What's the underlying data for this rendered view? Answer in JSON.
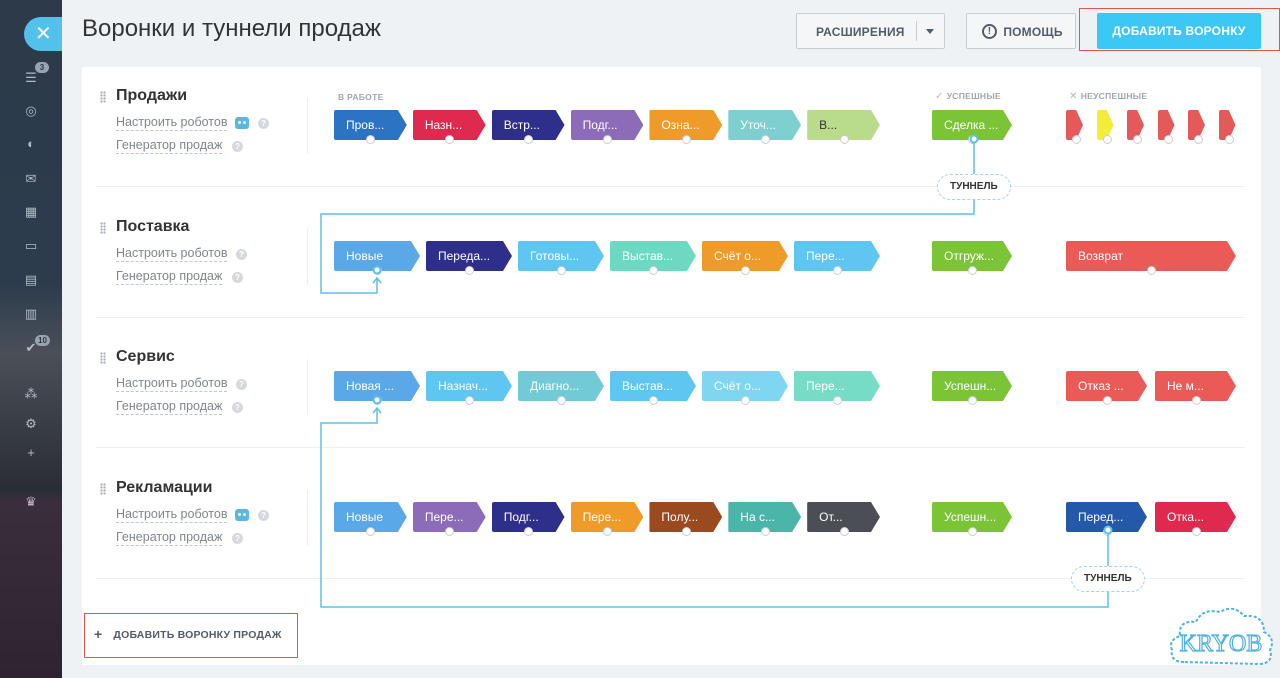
{
  "header": {
    "title": "Воронки и туннели продаж",
    "extensions_label": "РАСШИРЕНИЯ",
    "help_label": "ПОМОЩЬ",
    "add_funnel_label": "ДОБАВИТЬ ВОРОНКУ"
  },
  "sidebar": {
    "badges": [
      "3",
      "10"
    ]
  },
  "column_headers": {
    "in_work": "В РАБОТЕ",
    "success": "УСПЕШНЫЕ",
    "fail": "НЕУСПЕШНЫЕ"
  },
  "links": {
    "robots": "Настроить роботов",
    "generator": "Генератор продаж"
  },
  "funnels": [
    {
      "name": "Продажи",
      "stages": [
        {
          "label": "Пров...",
          "color": "#2d73c4"
        },
        {
          "label": "Назн...",
          "color": "#e0294f"
        },
        {
          "label": "Встр...",
          "color": "#2e2f8a"
        },
        {
          "label": "Подг...",
          "color": "#8c6bb8"
        },
        {
          "label": "Озна...",
          "color": "#ef9b2a"
        },
        {
          "label": "Уточ...",
          "color": "#7dcfd0"
        },
        {
          "label": "В...",
          "color": "#b8db8c"
        }
      ],
      "success": [
        {
          "label": "Сделка ...",
          "color": "#7bc436"
        }
      ],
      "fail_flags": [
        "#e45a5a",
        "#f2ed3a",
        "#e45a5a",
        "#e45a5a",
        "#e45a5a",
        "#e45a5a"
      ]
    },
    {
      "name": "Поставка",
      "stages": [
        {
          "label": "Новые",
          "color": "#5aa8e8"
        },
        {
          "label": "Переда...",
          "color": "#2e2f8a"
        },
        {
          "label": "Готовы...",
          "color": "#5ec6f0"
        },
        {
          "label": "Выстав...",
          "color": "#6ed9c2"
        },
        {
          "label": "Счёт о...",
          "color": "#ef9b2a"
        },
        {
          "label": "Пере...",
          "color": "#5ec6f0"
        }
      ],
      "success": [
        {
          "label": "Отгруж...",
          "color": "#7bc436"
        }
      ],
      "fail": [
        {
          "label": "Возврат",
          "color": "#ea5b58"
        }
      ]
    },
    {
      "name": "Сервис",
      "stages": [
        {
          "label": "Новая ...",
          "color": "#5aa8e8"
        },
        {
          "label": "Назнач...",
          "color": "#5ec6f0"
        },
        {
          "label": "Диагно...",
          "color": "#72cad6"
        },
        {
          "label": "Выстав...",
          "color": "#5ec6f0"
        },
        {
          "label": "Счёт о...",
          "color": "#7fd6f0"
        },
        {
          "label": "Пере...",
          "color": "#76dcc5"
        }
      ],
      "success": [
        {
          "label": "Успешн...",
          "color": "#7bc436"
        }
      ],
      "fail": [
        {
          "label": "Отказ ...",
          "color": "#ea5b58"
        },
        {
          "label": "Не м...",
          "color": "#ea5b58"
        }
      ]
    },
    {
      "name": "Рекламации",
      "stages": [
        {
          "label": "Новые",
          "color": "#5aa8e8"
        },
        {
          "label": "Пере...",
          "color": "#8c6bb8"
        },
        {
          "label": "Подг...",
          "color": "#2e2f8a"
        },
        {
          "label": "Пере...",
          "color": "#ef9b2a"
        },
        {
          "label": "Полу...",
          "color": "#9b4a1f"
        },
        {
          "label": "На с...",
          "color": "#4ab5a8"
        },
        {
          "label": "От...",
          "color": "#4b4f55"
        }
      ],
      "success": [
        {
          "label": "Успешн...",
          "color": "#7bc436"
        }
      ],
      "fail": [
        {
          "label": "Перед...",
          "color": "#2458a8"
        },
        {
          "label": "Отка...",
          "color": "#e0294f"
        }
      ]
    }
  ],
  "tunnels": [
    "ТУННЕЛЬ",
    "ТУННЕЛЬ"
  ],
  "add_sales_funnel_label": "ДОБАВИТЬ ВОРОНКУ ПРОДАЖ",
  "watermark": "KRYOB"
}
